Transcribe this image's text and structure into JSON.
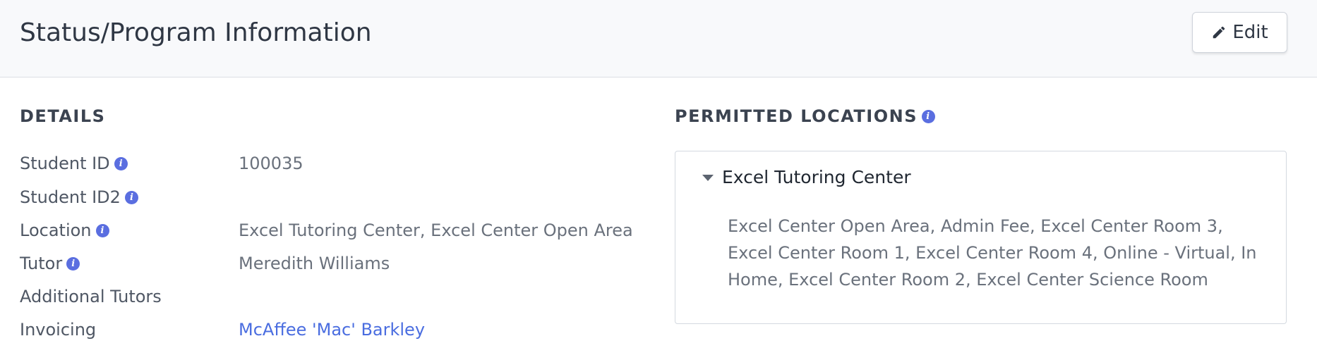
{
  "header": {
    "title": "Status/Program Information",
    "edit_label": "Edit"
  },
  "details": {
    "heading": "DETAILS",
    "rows": [
      {
        "label": "Student ID",
        "value": "100035",
        "has_info": true
      },
      {
        "label": "Student ID2",
        "value": "",
        "has_info": true
      },
      {
        "label": "Location",
        "value": "Excel Tutoring Center, Excel Center Open Area",
        "has_info": true
      },
      {
        "label": "Tutor",
        "value": "Meredith Williams",
        "has_info": true
      },
      {
        "label": "Additional Tutors",
        "value": "",
        "has_info": false
      },
      {
        "label": "Invoicing",
        "value": "McAffee 'Mac' Barkley",
        "has_info": false,
        "is_link": true
      }
    ]
  },
  "permitted_locations": {
    "heading": "PERMITTED LOCATIONS",
    "groups": [
      {
        "name": "Excel Tutoring Center",
        "expanded": true,
        "locations": "Excel Center Open Area, Admin Fee, Excel Center Room 3, Excel Center Room 1, Excel Center Room 4, Online - Virtual, In Home, Excel Center Room 2, Excel Center Science Room"
      }
    ]
  },
  "icons": {
    "info": "info-icon",
    "edit": "pencil-icon",
    "caret": "caret-down-icon"
  },
  "colors": {
    "accent": "#5a6ee0",
    "link": "#4a6de0",
    "header_bg": "#f8f9fb"
  }
}
